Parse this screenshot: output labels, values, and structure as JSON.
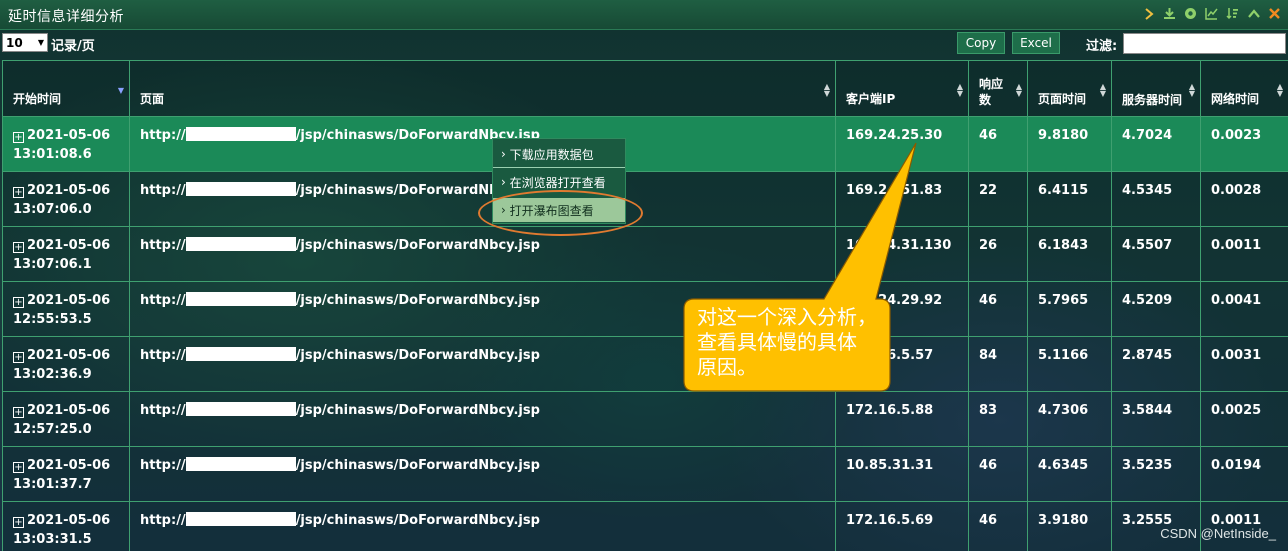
{
  "window": {
    "title": "延时信息详细分析",
    "icons": [
      "chevron-right-icon",
      "download-icon",
      "globe-icon",
      "line-chart-icon",
      "sort-icon",
      "chevron-up-icon",
      "close-icon"
    ]
  },
  "toolbar": {
    "page_size": "10",
    "per_page_label": "记录/页",
    "copy_label": "Copy",
    "excel_label": "Excel",
    "filter_label": "过滤:",
    "filter_value": ""
  },
  "table": {
    "columns": [
      "开始时间",
      "页面",
      "客户端IP",
      "响应数",
      "页面时间",
      "服务器时间",
      "网络时间"
    ],
    "rows": [
      {
        "date": "2021-05-06",
        "time": "13:01:08.6",
        "url_prefix": "http://",
        "url_suffix": "/jsp/chinasws/DoForwardNbcy.jsp",
        "ip": "169.24.25.30",
        "responses": "46",
        "page_time": "9.8180",
        "server_time": "4.7024",
        "network_time": "0.0023"
      },
      {
        "date": "2021-05-06",
        "time": "13:07:06.0",
        "url_prefix": "http://",
        "url_suffix": "/jsp/chinasws/DoForwardNbc",
        "ip": "169.24.51.83",
        "responses": "22",
        "page_time": "6.4115",
        "server_time": "4.5345",
        "network_time": "0.0028"
      },
      {
        "date": "2021-05-06",
        "time": "13:07:06.1",
        "url_prefix": "http://",
        "url_suffix": "/jsp/chinasws/DoForwardNbcy.jsp",
        "ip": "169.24.31.130",
        "responses": "26",
        "page_time": "6.1843",
        "server_time": "4.5507",
        "network_time": "0.0011"
      },
      {
        "date": "2021-05-06",
        "time": "12:55:53.5",
        "url_prefix": "http://",
        "url_suffix": "/jsp/chinasws/DoForwardNbcy.jsp",
        "ip": "169.24.29.92",
        "responses": "46",
        "page_time": "5.7965",
        "server_time": "4.5209",
        "network_time": "0.0041"
      },
      {
        "date": "2021-05-06",
        "time": "13:02:36.9",
        "url_prefix": "http://",
        "url_suffix": "/jsp/chinasws/DoForwardNbcy.jsp",
        "ip": "172.16.5.57",
        "responses": "84",
        "page_time": "5.1166",
        "server_time": "2.8745",
        "network_time": "0.0031"
      },
      {
        "date": "2021-05-06",
        "time": "12:57:25.0",
        "url_prefix": "http://",
        "url_suffix": "/jsp/chinasws/DoForwardNbcy.jsp",
        "ip": "172.16.5.88",
        "responses": "83",
        "page_time": "4.7306",
        "server_time": "3.5844",
        "network_time": "0.0025"
      },
      {
        "date": "2021-05-06",
        "time": "13:01:37.7",
        "url_prefix": "http://",
        "url_suffix": "/jsp/chinasws/DoForwardNbcy.jsp",
        "ip": "10.85.31.31",
        "responses": "46",
        "page_time": "4.6345",
        "server_time": "3.5235",
        "network_time": "0.0194"
      },
      {
        "date": "2021-05-06",
        "time": "13:03:31.5",
        "url_prefix": "http://",
        "url_suffix": "/jsp/chinasws/DoForwardNbcy.jsp",
        "ip": "172.16.5.69",
        "responses": "46",
        "page_time": "3.9180",
        "server_time": "3.2555",
        "network_time": "0.0011"
      }
    ]
  },
  "context_menu": {
    "items": [
      "下载应用数据包",
      "在浏览器打开查看",
      "打开瀑布图查看"
    ],
    "highlighted_index": 2
  },
  "callout": {
    "lines": [
      "对这一个深入分析，",
      "查看具体慢的具体",
      "原因。"
    ],
    "fill_color": "#ffc000"
  },
  "watermark": "CSDN @NetInside_",
  "colors": {
    "titlebar": "#1f5e42",
    "selected_row": "#1b8a58",
    "grid_border": "#3fa070",
    "highlight_ring": "#e07a30"
  }
}
